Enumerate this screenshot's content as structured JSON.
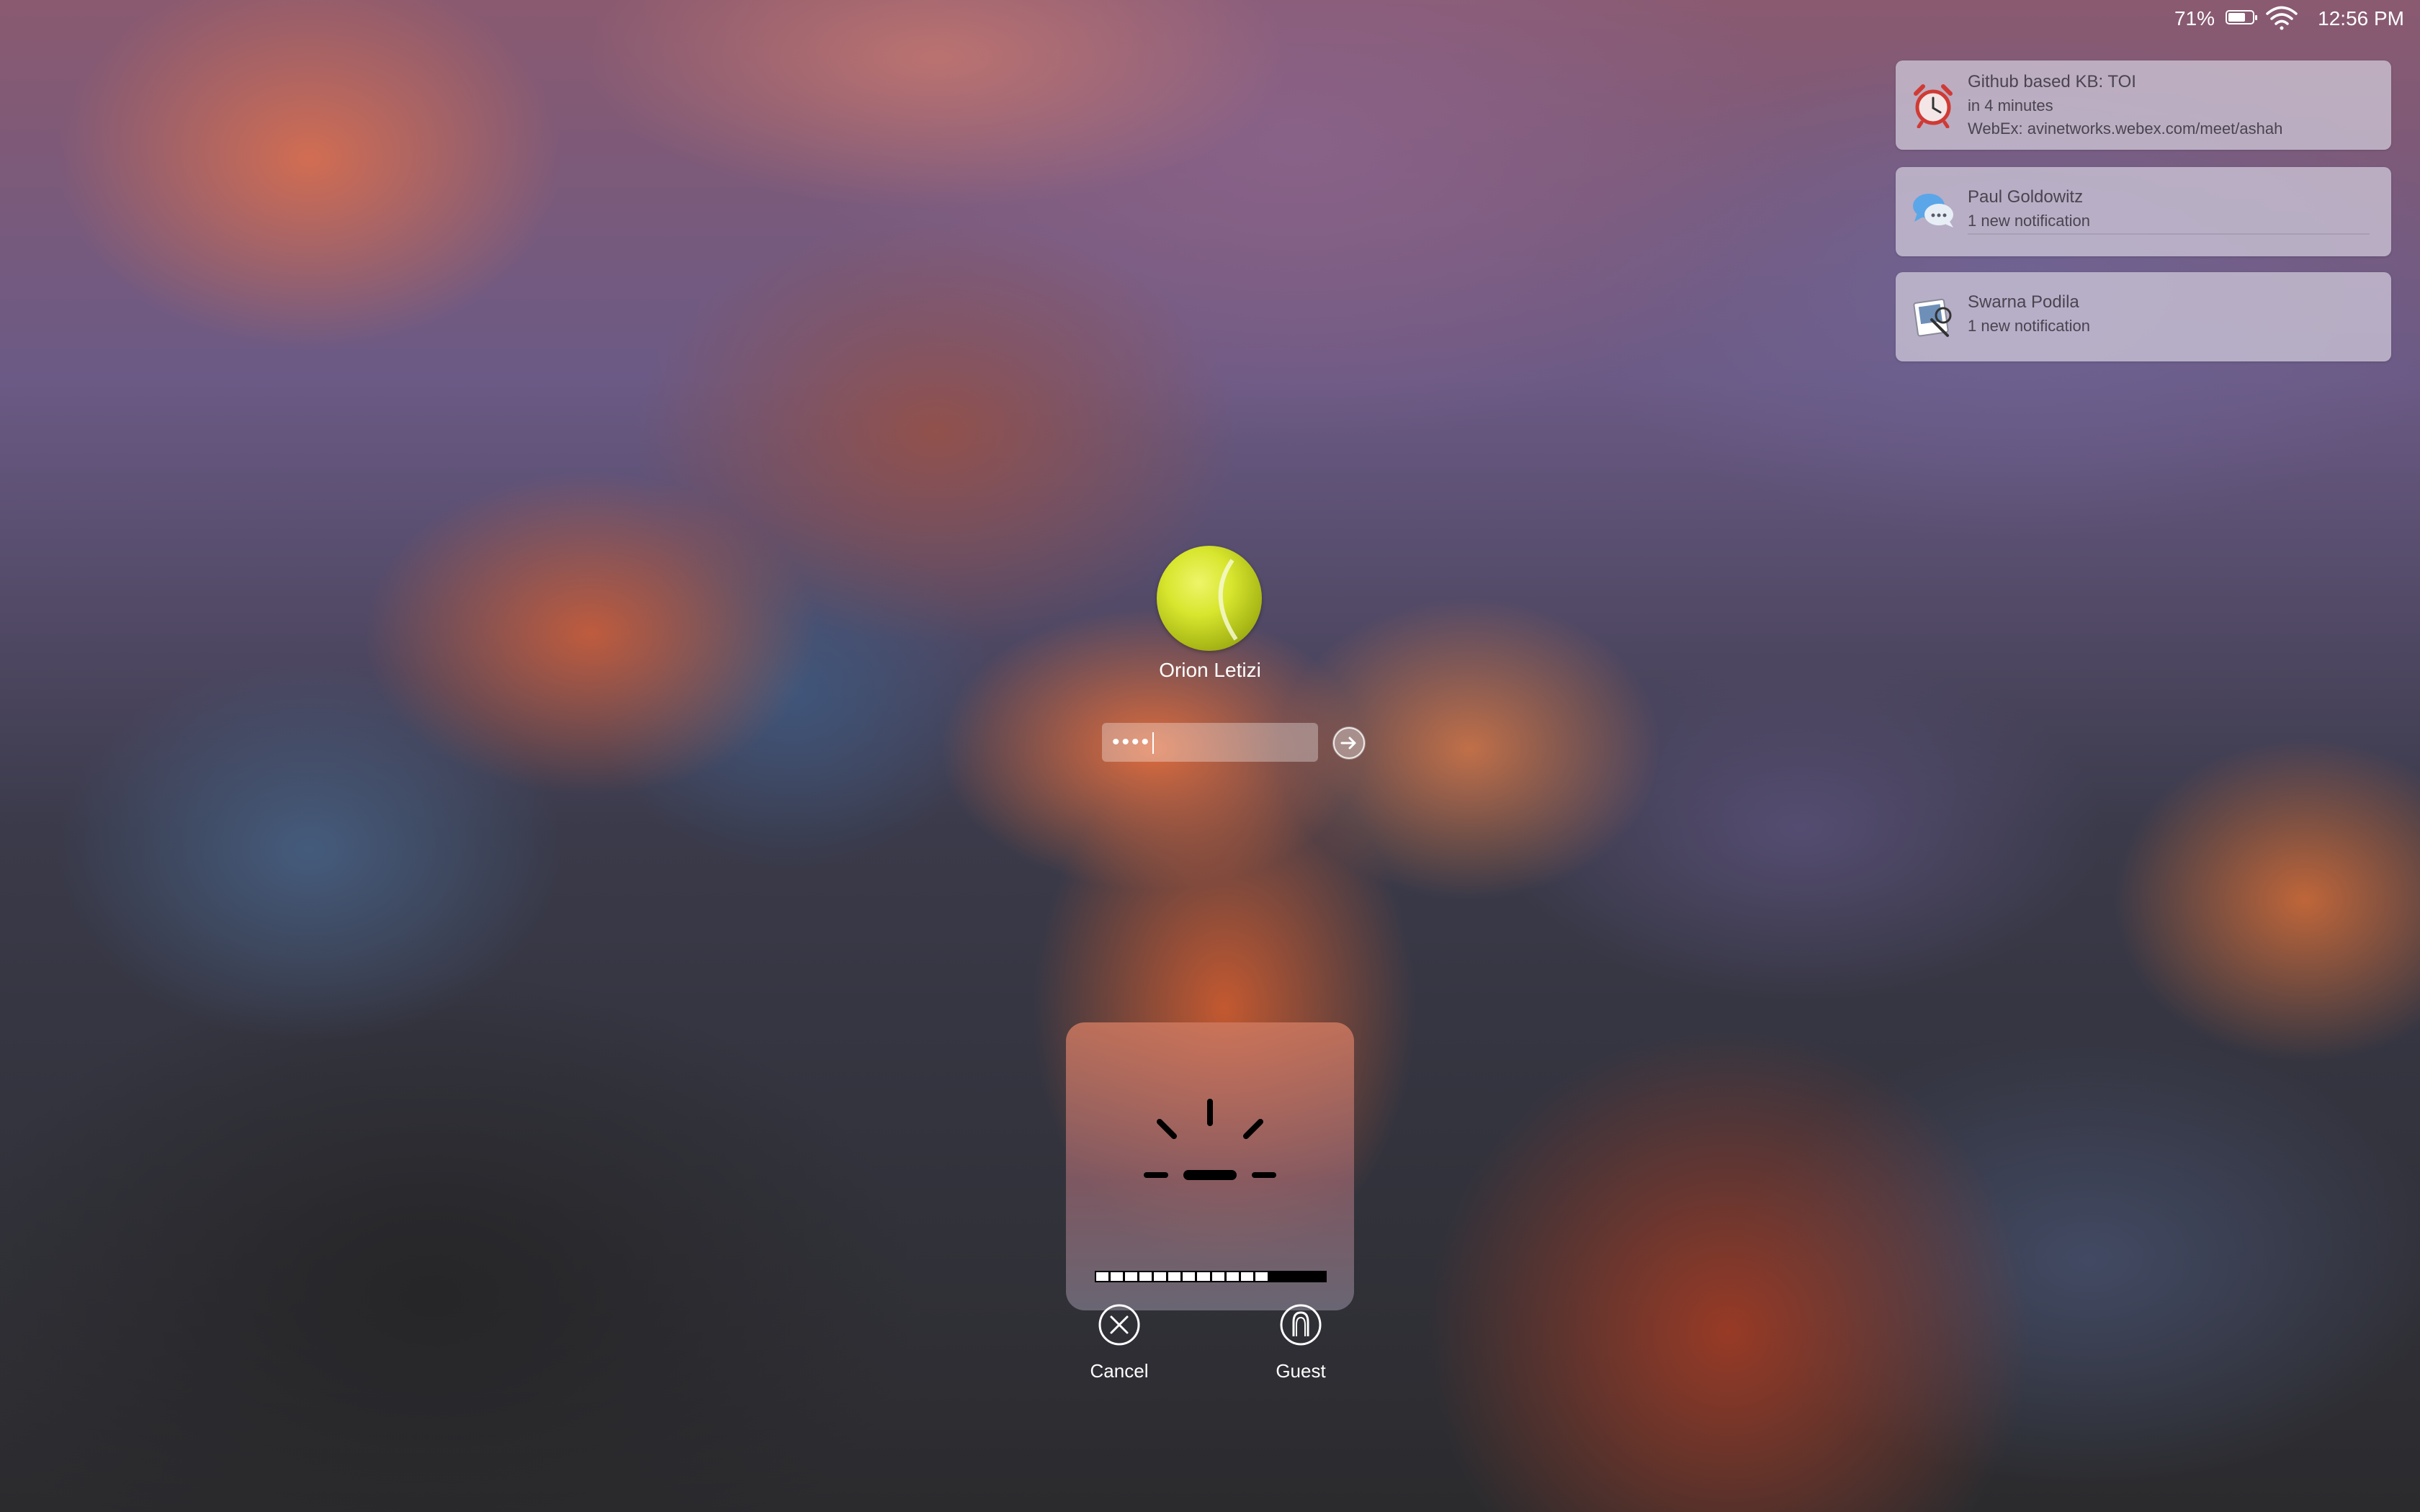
{
  "status_bar": {
    "battery_percent": "71%",
    "battery_level": 0.71,
    "time": "12:56 PM",
    "icons": [
      "battery-icon",
      "wifi-icon"
    ]
  },
  "notifications": [
    {
      "app_icon": "alarm-clock-icon",
      "title": "Github based KB: TOI",
      "line2": "in 4 minutes",
      "line3": "WebEx: avinetworks.webex.com/meet/ashah"
    },
    {
      "app_icon": "messages-icon",
      "title": "Paul Goldowitz",
      "line2": "1 new notification"
    },
    {
      "app_icon": "preview-icon",
      "title": "Swarna Podila",
      "line2": "1 new notification"
    }
  ],
  "login": {
    "avatar": "tennis-ball-avatar",
    "username": "Orion Letizi",
    "password_mask": "••••",
    "submit_icon": "arrow-right-icon"
  },
  "brightness_hud": {
    "icon": "brightness-icon",
    "segments_total": 16,
    "segments_filled": 12
  },
  "actions": {
    "cancel_label": "Cancel",
    "guest_label": "Guest"
  },
  "colors": {
    "notification_bg": "#d2cddc",
    "notification_text": "#4a4450",
    "avatar_ball": "#d8e62e"
  }
}
